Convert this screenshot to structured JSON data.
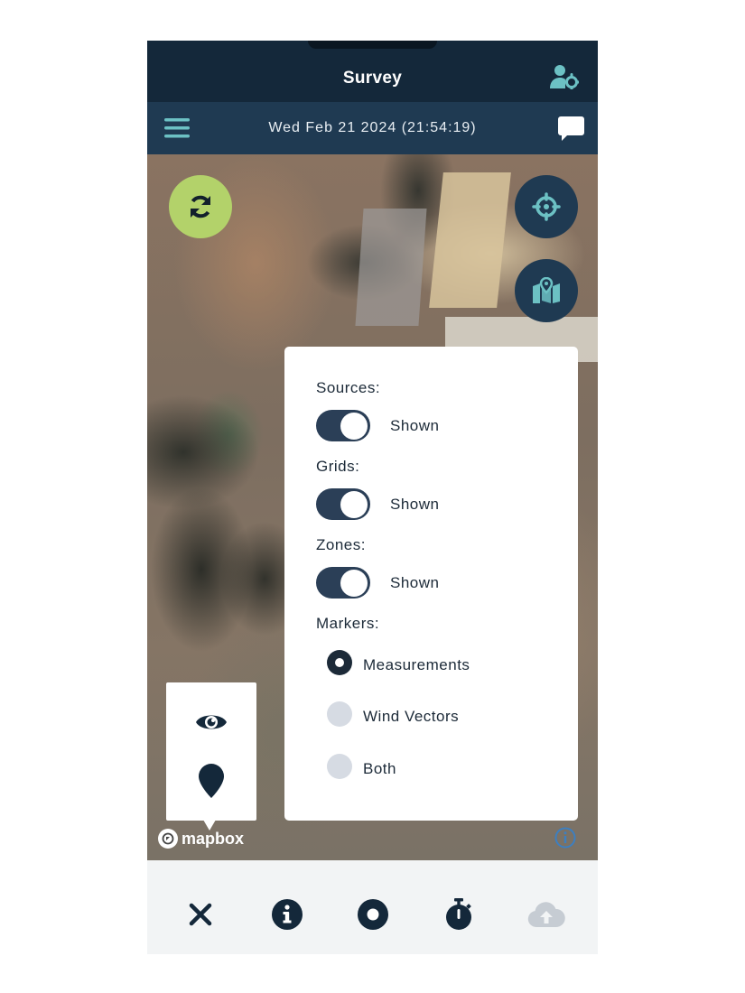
{
  "header": {
    "title": "Survey",
    "datetime": "Wed Feb 21 2024 (21:54:19)"
  },
  "icons": {
    "title_right": "user-gear-icon",
    "menu": "hamburger-menu-icon",
    "chat": "chat-bubble-icon",
    "refresh": "refresh-icon",
    "locate": "crosshair-icon",
    "map_layers": "map-pin-icon",
    "eye": "eye-icon",
    "pin": "map-marker-icon",
    "attribution": "info-icon"
  },
  "panel": {
    "sources": {
      "label": "Sources:",
      "state": "Shown",
      "on": true
    },
    "grids": {
      "label": "Grids:",
      "state": "Shown",
      "on": true
    },
    "zones": {
      "label": "Zones:",
      "state": "Shown",
      "on": true
    },
    "markers": {
      "label": "Markers:",
      "options": [
        {
          "label": "Measurements",
          "selected": true
        },
        {
          "label": "Wind Vectors",
          "selected": false
        },
        {
          "label": "Both",
          "selected": false
        }
      ]
    }
  },
  "map": {
    "logo_text": "mapbox"
  },
  "bottom_bar": {
    "buttons": [
      {
        "name": "close",
        "icon": "close-icon"
      },
      {
        "name": "info",
        "icon": "info-circle-icon"
      },
      {
        "name": "record",
        "icon": "record-icon"
      },
      {
        "name": "timer",
        "icon": "stopwatch-icon"
      },
      {
        "name": "upload",
        "icon": "cloud-upload-icon",
        "disabled": true
      }
    ]
  },
  "colors": {
    "header_bg": "#14283a",
    "subheader_bg": "#1f3a52",
    "accent_teal": "#6cc1c4",
    "refresh_green": "#b3d26a",
    "toggle_track": "#2b3f57",
    "radio_off": "#d6dbe3",
    "upload_disabled": "#c6ccd3"
  }
}
